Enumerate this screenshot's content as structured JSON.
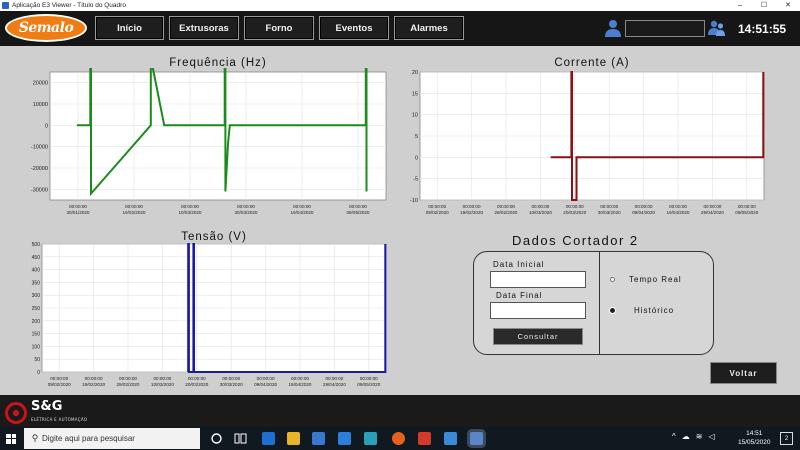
{
  "window": {
    "title": "Aplicação E3 Viewer - Título do Quadro",
    "controls": [
      "–",
      "☐",
      "✕"
    ]
  },
  "header": {
    "logo_text": "Semalo",
    "nav": [
      "Início",
      "Extrusoras",
      "Forno",
      "Eventos",
      "Alarmes"
    ],
    "user_field_value": "",
    "clock": "14:51:55"
  },
  "colors": {
    "frequencia": "#1a8c1a",
    "corrente": "#8b1010",
    "tensao": "#1a1aa8"
  },
  "chart_data": [
    {
      "type": "line",
      "title": "Frequência (Hz)",
      "ylim": [
        -35000,
        25000
      ],
      "yticks": [
        "20000",
        "10000",
        "0",
        "-10000",
        "-20000",
        "-30000"
      ],
      "yticks_values": [
        20000,
        10000,
        0,
        -10000,
        -20000,
        -30000
      ],
      "xticks": [
        [
          "00:00:00",
          "30/01/2020"
        ],
        [
          "00:00:00",
          "19/02/2020"
        ],
        [
          "00:00:00",
          "10/03/2020"
        ],
        [
          "00:00:00",
          "30/03/2020"
        ],
        [
          "00:00:00",
          "19/04/2020"
        ],
        [
          "00:00:00",
          "09/05/2020"
        ]
      ],
      "xrange": [
        0,
        100
      ],
      "grid": true,
      "series": [
        {
          "x": [
            8,
            12,
            12,
            12.2,
            12.2,
            30,
            30,
            30.2,
            34,
            52,
            52,
            52.2,
            52.2,
            53,
            53.5,
            54,
            94,
            94,
            94.2,
            94.2
          ],
          "y": [
            0,
            0,
            32000,
            32000,
            -32000,
            0,
            32000,
            30000,
            0,
            0,
            31000,
            31000,
            -31000,
            -8000,
            0,
            0,
            0,
            31000,
            31000,
            -31000
          ]
        }
      ]
    },
    {
      "type": "line",
      "title": "Corrente (A)",
      "ylim": [
        -10,
        20
      ],
      "yticks": [
        "20",
        "15",
        "10",
        "5",
        "0",
        "-5",
        "-10"
      ],
      "yticks_values": [
        20,
        15,
        10,
        5,
        0,
        -5,
        -10
      ],
      "xticks": [
        [
          "00:00:00",
          "09/02/2020"
        ],
        [
          "00:00:00",
          "19/02/2020"
        ],
        [
          "00:00:00",
          "29/02/2020"
        ],
        [
          "00:00:00",
          "10/03/2020"
        ],
        [
          "00:00:00",
          "20/03/2020"
        ],
        [
          "00:00:00",
          "30/03/2020"
        ],
        [
          "00:00:00",
          "09/04/2020"
        ],
        [
          "00:00:00",
          "19/04/2020"
        ],
        [
          "00:00:00",
          "29/04/2020"
        ],
        [
          "00:00:00",
          "09/05/2020"
        ]
      ],
      "xrange": [
        0,
        100
      ],
      "grid": true,
      "series": [
        {
          "x": [
            38,
            44,
            44,
            44.2,
            44.2,
            45.5,
            45.5,
            46.5,
            46.5,
            99.8,
            99.8
          ],
          "y": [
            0,
            0,
            20,
            20,
            -10,
            -10,
            0,
            0,
            0,
            0,
            20
          ]
        }
      ]
    },
    {
      "type": "line",
      "title": "Tensão (V)",
      "ylim": [
        0,
        500
      ],
      "yticks": [
        "500",
        "450",
        "400",
        "350",
        "300",
        "250",
        "200",
        "150",
        "100",
        "50",
        "0"
      ],
      "yticks_values": [
        500,
        450,
        400,
        350,
        300,
        250,
        200,
        150,
        100,
        50,
        0
      ],
      "xticks": [
        [
          "00:00:00",
          "09/02/2020"
        ],
        [
          "00:00:00",
          "19/02/2020"
        ],
        [
          "00:00:00",
          "29/02/2020"
        ],
        [
          "00:00:00",
          "10/03/2020"
        ],
        [
          "00:00:00",
          "20/03/2020"
        ],
        [
          "00:00:00",
          "30/03/2020"
        ],
        [
          "00:00:00",
          "09/04/2020"
        ],
        [
          "00:00:00",
          "19/04/2020"
        ],
        [
          "00:00:00",
          "29/04/2020"
        ],
        [
          "00:00:00",
          "09/05/2020"
        ]
      ],
      "xrange": [
        0,
        100
      ],
      "grid": true,
      "series": [
        {
          "x": [
            42.5,
            42.5,
            42.7,
            42.7,
            44,
            44,
            44.2,
            44.2,
            99.8,
            99.8
          ],
          "y": [
            0,
            500,
            500,
            0,
            0,
            500,
            500,
            0,
            0,
            500
          ]
        }
      ]
    }
  ],
  "cutter": {
    "title": "Dados Cortador 2",
    "initial_date_label": "Data Inicial",
    "initial_date_value": "",
    "final_date_label": "Data Final",
    "final_date_value": "",
    "consult_label": "Consultar",
    "mode_options": [
      "Tempo Real",
      "Histórico"
    ],
    "selected_mode": "Histórico"
  },
  "back_label": "Voltar",
  "footer": {
    "brand": "S&G",
    "brand_sub": "ELÉTRICA E AUTOMAÇÃO"
  },
  "taskbar": {
    "search_placeholder": "Digite aqui para pesquisar",
    "time": "14:51",
    "date": "15/05/2020",
    "notifications": "2"
  }
}
